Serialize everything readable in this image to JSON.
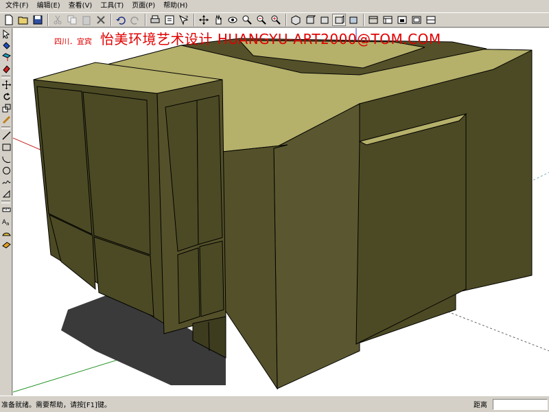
{
  "menu": {
    "items": [
      "文件(F)",
      "编辑(E)",
      "查看(V)",
      "工具(T)",
      "页面(P)",
      "帮助(H)"
    ]
  },
  "toolbar": {
    "buttons": [
      "new-file-icon",
      "open-folder-icon",
      "save-icon",
      "cut-icon",
      "copy-icon",
      "paste-icon",
      "delete-icon",
      "undo-icon",
      "redo-icon",
      "print-icon",
      "model-info-icon",
      "context-help-icon",
      "orbit-icon",
      "pan-icon",
      "walk-icon",
      "zoom-icon",
      "zoom-window-icon",
      "zoom-extents-icon",
      "iso-view-icon",
      "top-view-icon",
      "front-view-icon",
      "right-view-icon",
      "back-view-icon",
      "left-view-icon",
      "xray-icon",
      "wireframe-icon",
      "hidden-line-icon",
      "shaded-icon",
      "shaded-texture-icon"
    ],
    "active_button": "right-view-icon"
  },
  "left_tools": [
    "select-arrow-icon",
    "paint-bucket-icon",
    "component-icon",
    "eraser-icon",
    "move-icon",
    "rotate-icon",
    "scale-icon",
    "tape-measure-icon",
    "line-icon",
    "rectangle-icon",
    "arc-icon",
    "circle-icon",
    "freehand-icon",
    "polygon-icon",
    "dimension-icon",
    "text-label-icon",
    "protractor-icon",
    "section-plane-icon"
  ],
  "banner": {
    "place": "四川．宜宾",
    "title": "怡美环境艺术设计  HUANGYU-ART2000@TOM.COM"
  },
  "viewport": {
    "model_colors": {
      "top": "#b5b06a",
      "front_dark": "#4c4a24",
      "front_mid": "#5a5730",
      "side": "#54512a",
      "edge": "#000000",
      "shadow": "#3a3a3a"
    },
    "axis_colors": {
      "red": "#c82828",
      "green": "#209020",
      "blue": "#3030c8"
    }
  },
  "status": {
    "text": "准备就绪。需要帮助，请按[F1]键。",
    "distance_label": "距离",
    "distance_value": ""
  }
}
